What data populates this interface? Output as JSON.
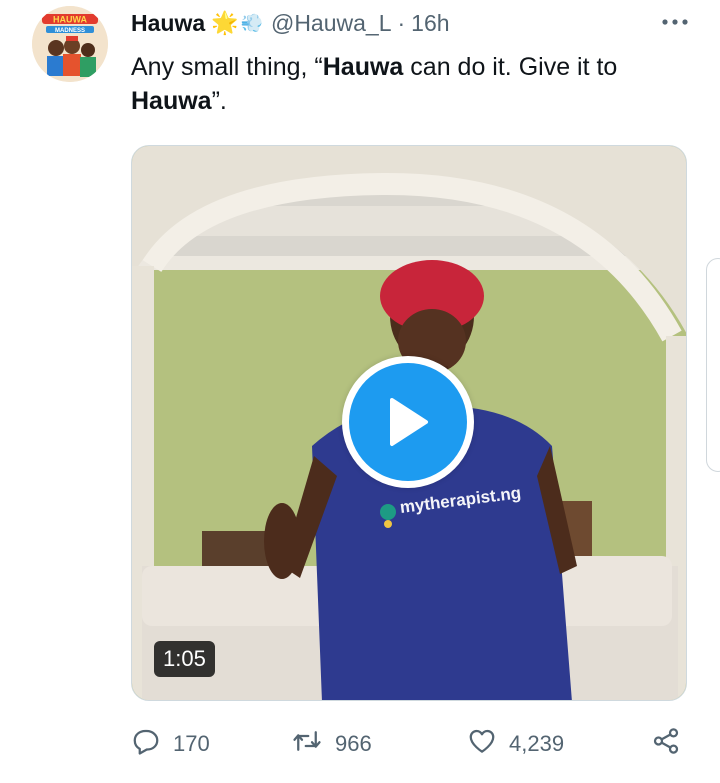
{
  "tweet": {
    "display_name": "Hauwa",
    "emoji_sun": "🌟",
    "emoji_dash": "💨",
    "handle": "@Hauwa_L",
    "separator": "·",
    "time": "16h",
    "text": {
      "part1": "Any small thing, “",
      "bold1": "Hauwa",
      "part2": " can do it. Give it to ",
      "bold2": "Hauwa",
      "part3": "”."
    }
  },
  "avatar": {
    "label_top": "HAUWA",
    "label_bottom": "MADNESS"
  },
  "video": {
    "duration": "1:05",
    "shirt_text": "mytherapist.ng"
  },
  "actions": {
    "replies": "170",
    "reposts": "966",
    "likes": "4,239"
  },
  "icons": {
    "more": "more-horizontal-icon",
    "reply": "reply-icon",
    "repost": "repost-icon",
    "like": "heart-icon",
    "share": "share-icon",
    "play": "play-icon"
  },
  "colors": {
    "accent": "#1d9bf0",
    "muted": "#536471",
    "text": "#0f1419"
  }
}
